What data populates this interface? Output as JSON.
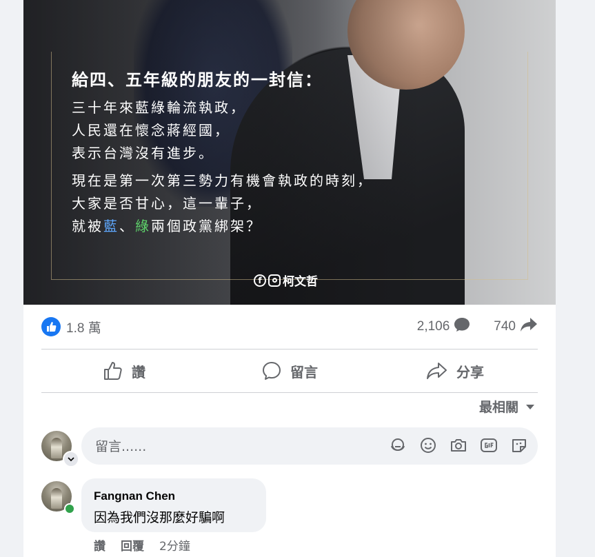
{
  "post": {
    "image": {
      "title": "給四、五年級的朋友的一封信：",
      "lines": [
        "三十年來藍綠輪流執政，",
        "人民還在懷念蔣經國，",
        "表示台灣沒有進步。",
        "現在是第一次第三勢力有機會執政的時刻，",
        "大家是否甘心，這一輩子，"
      ],
      "last_line_prefix": "就被",
      "last_line_blue": "藍",
      "last_line_sep": "、",
      "last_line_green": "綠",
      "last_line_suffix": "兩個政黨綁架？",
      "attribution": "柯文哲"
    },
    "reactions": {
      "count": "1.8 萬",
      "comment_count": "2,106",
      "share_count": "740"
    },
    "actions": {
      "like": "讚",
      "comment": "留言",
      "share": "分享"
    }
  },
  "comments": {
    "sort_label": "最相關",
    "composer_placeholder": "留言......",
    "items": [
      {
        "author": "Fangnan Chen",
        "text": "因為我們沒那麼好騙啊",
        "like_label": "讚",
        "reply_label": "回覆",
        "time": "2分鐘"
      }
    ]
  },
  "colors": {
    "accent": "#1877f2",
    "secondary_text": "#65676b",
    "online": "#31a24c"
  }
}
